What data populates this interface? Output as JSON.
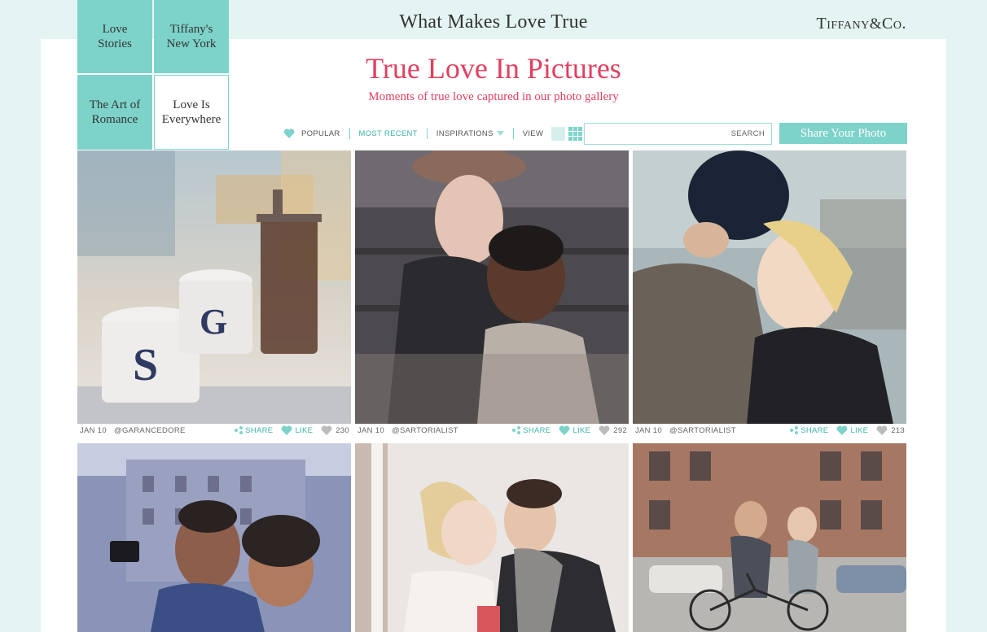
{
  "header": {
    "site_title": "What Makes Love True",
    "brand_main": "Tiffany",
    "brand_amp": "&",
    "brand_co": "Co."
  },
  "nav": [
    {
      "label_1": "Love",
      "label_2": "Stories"
    },
    {
      "label_1": "Tiffany's",
      "label_2": "New York"
    },
    {
      "label_1": "The Art of",
      "label_2": "Romance"
    },
    {
      "label_1": "Love Is",
      "label_2": "Everywhere"
    }
  ],
  "hero": {
    "title": "True Love In Pictures",
    "subtitle": "Moments of true love captured in our photo gallery"
  },
  "toolbar": {
    "popular": "POPULAR",
    "most_recent": "MOST RECENT",
    "inspirations": "INSPIRATIONS",
    "view": "VIEW",
    "search_label": "SEARCH",
    "search_value": "",
    "share_button": "Share Your Photo"
  },
  "colors": {
    "accent": "#7dd3c9",
    "accent_text": "#3bb3a7",
    "title": "#e2405f",
    "background": "#e3f4f2"
  },
  "photos": [
    {
      "date": "JAN 10",
      "author": "@GARANCEDORE",
      "share": "SHARE",
      "like": "LIKE",
      "likes": "230"
    },
    {
      "date": "JAN 10",
      "author": "@SARTORIALIST",
      "share": "SHARE",
      "like": "LIKE",
      "likes": "292"
    },
    {
      "date": "JAN 10",
      "author": "@SARTORIALIST",
      "share": "SHARE",
      "like": "LIKE",
      "likes": "213"
    },
    {
      "date": "",
      "author": "",
      "share": "",
      "like": "",
      "likes": ""
    },
    {
      "date": "",
      "author": "",
      "share": "",
      "like": "",
      "likes": ""
    },
    {
      "date": "",
      "author": "",
      "share": "",
      "like": "",
      "likes": ""
    }
  ]
}
